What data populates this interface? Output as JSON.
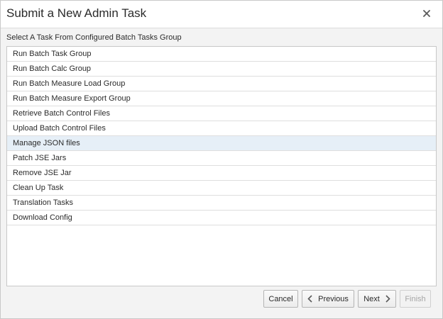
{
  "dialog": {
    "title": "Submit a New Admin Task",
    "close_icon": "close-icon"
  },
  "instruction": "Select A Task From Configured Batch Tasks Group",
  "tasks": [
    {
      "label": "Run Batch Task Group",
      "selected": false
    },
    {
      "label": "Run Batch Calc Group",
      "selected": false
    },
    {
      "label": "Run Batch Measure Load Group",
      "selected": false
    },
    {
      "label": "Run Batch Measure Export Group",
      "selected": false
    },
    {
      "label": "Retrieve Batch Control Files",
      "selected": false
    },
    {
      "label": "Upload Batch Control Files",
      "selected": false
    },
    {
      "label": "Manage JSON files",
      "selected": true
    },
    {
      "label": "Patch JSE Jars",
      "selected": false
    },
    {
      "label": "Remove JSE Jar",
      "selected": false
    },
    {
      "label": "Clean Up Task",
      "selected": false
    },
    {
      "label": "Translation Tasks",
      "selected": false
    },
    {
      "label": "Download Config",
      "selected": false
    }
  ],
  "footer": {
    "cancel_label": "Cancel",
    "previous_label": "Previous",
    "next_label": "Next",
    "finish_label": "Finish",
    "previous_icon": "chevron-left-icon",
    "next_icon": "chevron-right-icon"
  },
  "colors": {
    "selected_row": "#e6eff7",
    "disabled_text": "#a5a5a5"
  }
}
